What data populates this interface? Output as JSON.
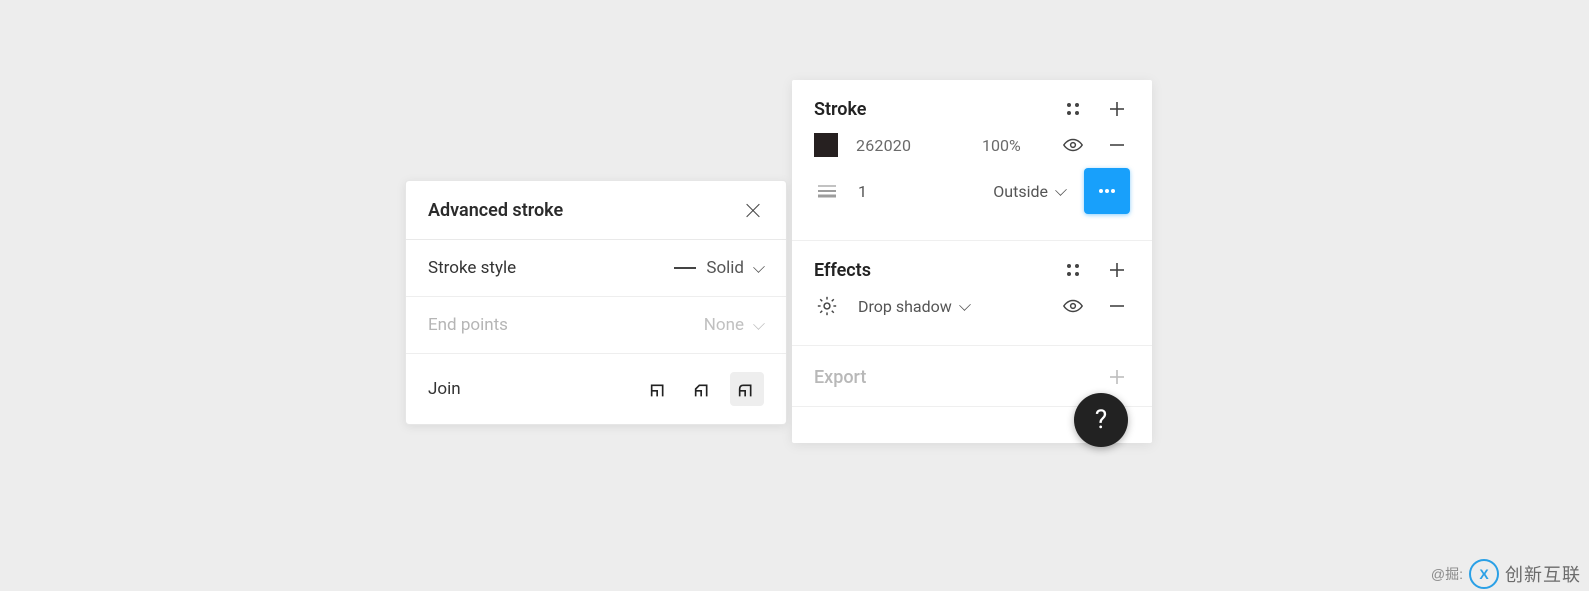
{
  "advanced": {
    "title": "Advanced stroke",
    "stroke_style_label": "Stroke style",
    "stroke_style_value": "Solid",
    "end_points_label": "End points",
    "end_points_value": "None",
    "join_label": "Join"
  },
  "stroke": {
    "title": "Stroke",
    "hex": "262020",
    "opacity": "100%",
    "weight": "1",
    "position": "Outside"
  },
  "effects": {
    "title": "Effects",
    "item": "Drop shadow"
  },
  "export": {
    "title": "Export"
  },
  "help_glyph": "?",
  "watermark": {
    "source": "@掘:",
    "brand": "创新互联"
  }
}
